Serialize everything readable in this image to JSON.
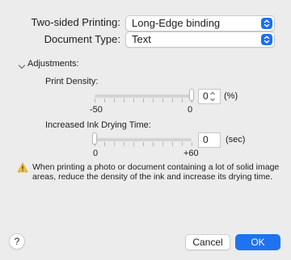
{
  "two_sided": {
    "label": "Two-sided Printing:",
    "value": "Long-Edge binding"
  },
  "document_type": {
    "label": "Document Type:",
    "value": "Text"
  },
  "adjustments": {
    "label": "Adjustments:",
    "print_density": {
      "label": "Print Density:",
      "value": "0",
      "unit": "(%)",
      "min_label": "-50",
      "max_label": "0",
      "range": [
        -50,
        0
      ],
      "level": 0
    },
    "drying_time": {
      "label": "Increased Ink Drying Time:",
      "value": "0",
      "unit": "(sec)",
      "min_label": "0",
      "max_label": "+60",
      "range": [
        0,
        60
      ],
      "level": 0
    }
  },
  "warning": {
    "line1": "When printing a photo or document containing a lot of solid image",
    "line2": "areas, reduce the density of the ink and increase its drying time."
  },
  "buttons": {
    "help": "?",
    "cancel": "Cancel",
    "ok": "OK"
  },
  "colors": {
    "accent": "#1f72f0",
    "background": "#ececec",
    "warning": "#f2c230"
  }
}
